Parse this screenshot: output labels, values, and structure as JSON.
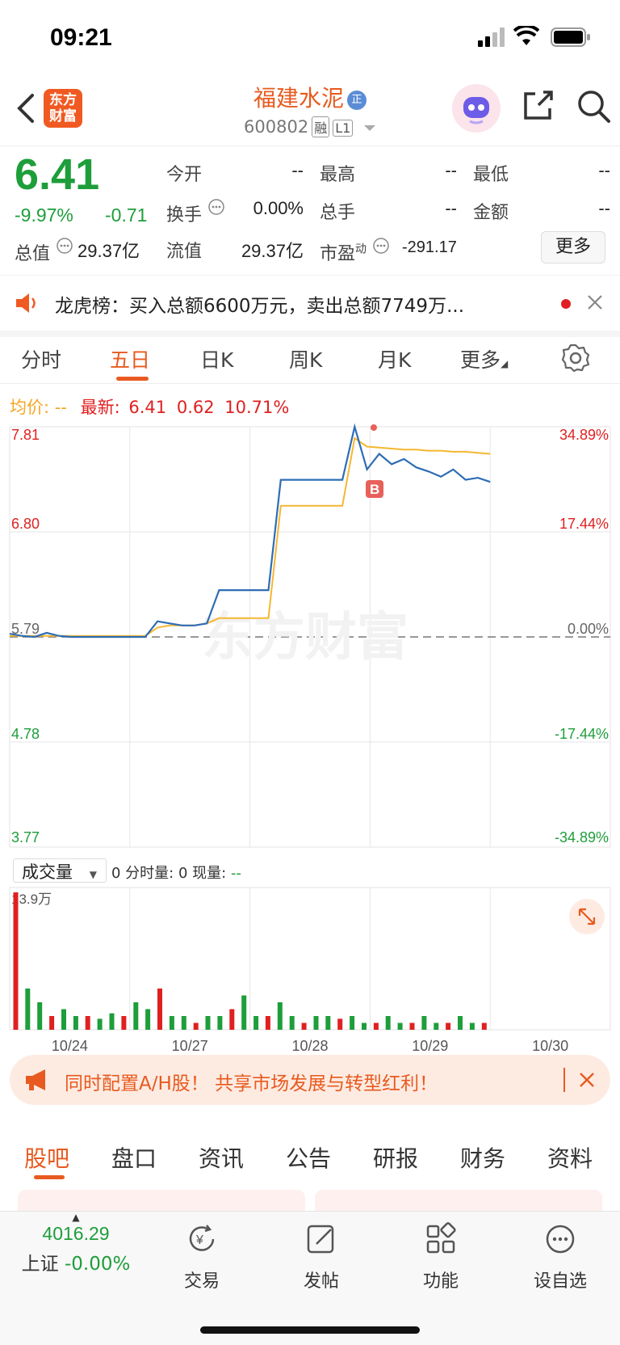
{
  "status_bar": {
    "time": "09:21"
  },
  "header": {
    "logo_text": "东方财富",
    "stock_name": "福建水泥",
    "badge": "正",
    "code": "600802",
    "tag_margin": "融",
    "tag_level": "L1"
  },
  "quote": {
    "price": "6.41",
    "change_pct": "-9.97%",
    "change": "-0.71",
    "open_label": "今开",
    "open": "--",
    "high_label": "最高",
    "high": "--",
    "low_label": "最低",
    "low": "--",
    "turnover_label": "换手",
    "turnover": "0.00%",
    "volume_label": "总手",
    "volume": "--",
    "amount_label": "金额",
    "amount": "--",
    "mktcap_label": "总值",
    "mktcap": "29.37亿",
    "float_label": "流值",
    "float": "29.37亿",
    "pe_label": "市盈",
    "pe_sup": "动",
    "pe": "-291.17",
    "more": "更多"
  },
  "notice": {
    "text": "龙虎榜：买入总额6600万元，卖出总额7749万..."
  },
  "tabs": [
    "分时",
    "五日",
    "日K",
    "周K",
    "月K",
    "更多"
  ],
  "active_tab": 1,
  "avg_info": {
    "avg_label": "均价:",
    "avg_val": "--",
    "latest_label": "最新:",
    "latest_price": "6.41",
    "latest_chg": "0.62",
    "latest_pct": "10.71%"
  },
  "chart_data": {
    "type": "line",
    "y_left_ticks": [
      "7.81",
      "6.80",
      "5.79",
      "4.78",
      "3.77"
    ],
    "y_right_ticks": [
      "34.89%",
      "17.44%",
      "0.00%",
      "-17.44%",
      "-34.89%"
    ],
    "x_labels": [
      "10/24",
      "10/27",
      "10/28",
      "10/29",
      "10/30"
    ],
    "watermark": "东方财富",
    "marker_label": "B",
    "series": [
      {
        "values": [
          5.82,
          5.8,
          5.79,
          5.83,
          5.8,
          5.79,
          5.79,
          5.79,
          5.79,
          5.79,
          5.79,
          5.79,
          5.94,
          5.92,
          5.9,
          5.9,
          5.92,
          6.24,
          6.24,
          6.24,
          6.24,
          6.24,
          7.3,
          7.3,
          7.3,
          7.3,
          7.3,
          7.3,
          7.81,
          7.4,
          7.55,
          7.45,
          7.5,
          7.42,
          7.38,
          7.33,
          7.4,
          7.3,
          7.32,
          7.28
        ]
      },
      {
        "values": [
          5.8,
          5.8,
          5.8,
          5.8,
          5.8,
          5.8,
          5.8,
          5.8,
          5.8,
          5.8,
          5.8,
          5.8,
          5.88,
          5.9,
          5.9,
          5.9,
          5.92,
          5.97,
          5.97,
          5.97,
          5.97,
          5.97,
          7.05,
          7.05,
          7.05,
          7.05,
          7.05,
          7.05,
          7.7,
          7.62,
          7.61,
          7.6,
          7.59,
          7.59,
          7.58,
          7.58,
          7.57,
          7.57,
          7.56,
          7.55
        ]
      }
    ],
    "volume": {
      "label": "成交量",
      "info": "0 分时量: 0 现量:",
      "current": "--",
      "max_label": "13.9万",
      "bars": [
        1,
        0.3,
        0.2,
        0.1,
        0.15,
        0.1,
        0.1,
        0.08,
        0.12,
        0.1,
        0.2,
        0.15,
        0.3,
        0.1,
        0.1,
        0.05,
        0.1,
        0.1,
        0.15,
        0.25,
        0.1,
        0.1,
        0.2,
        0.1,
        0.05,
        0.1,
        0.1,
        0.08,
        0.1,
        0.05,
        0.05,
        0.1,
        0.05,
        0.05,
        0.1,
        0.05,
        0.05,
        0.1,
        0.05,
        0.05
      ]
    }
  },
  "banner": {
    "text": "同时配置A/H股！ 共享市场发展与转型红利！"
  },
  "bottom_tabs": [
    "股吧",
    "盘口",
    "资讯",
    "公告",
    "研报",
    "财务",
    "资料"
  ],
  "bottom_nav": {
    "index_value": "4016.29",
    "index_name": "上证",
    "index_change": "-0.00%",
    "items": [
      "交易",
      "发帖",
      "功能",
      "设自选"
    ]
  }
}
